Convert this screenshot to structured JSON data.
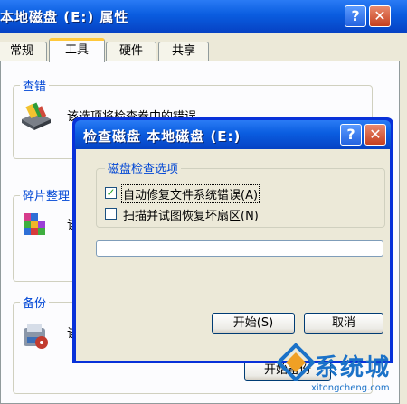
{
  "outer_window": {
    "title": "本地磁盘 (E:) 属性",
    "help_glyph": "?",
    "close_glyph": "✕",
    "tabs": [
      "常规",
      "工具",
      "硬件",
      "共享"
    ],
    "active_tab": "工具",
    "sections": {
      "error_check": {
        "label": "查错",
        "description": "该选项将检查卷中的错误。"
      },
      "defrag": {
        "label": "碎片整理",
        "description_partial": "该"
      },
      "backup": {
        "label": "备份",
        "description_partial": "该"
      }
    },
    "visible_button_partial": "开始备份"
  },
  "check_disk_dialog": {
    "title": "检查磁盘 本地磁盘 (E:)",
    "help_glyph": "?",
    "close_glyph": "✕",
    "group_label": "磁盘检查选项",
    "options": [
      {
        "label": "自动修复文件系统错误",
        "shortcut": "(A)",
        "checked": true
      },
      {
        "label": "扫描并试图恢复坏扇区",
        "shortcut": "(N)",
        "checked": false
      }
    ],
    "progress": 0,
    "start_button": "开始(S)",
    "cancel_button": "取消"
  },
  "watermark": {
    "brand": "系统城",
    "url": "xitongcheng.com"
  },
  "colors": {
    "titlebar": "#0a5de0",
    "accent_tab": "#ffc83c",
    "watermark": "#1b72c8"
  }
}
